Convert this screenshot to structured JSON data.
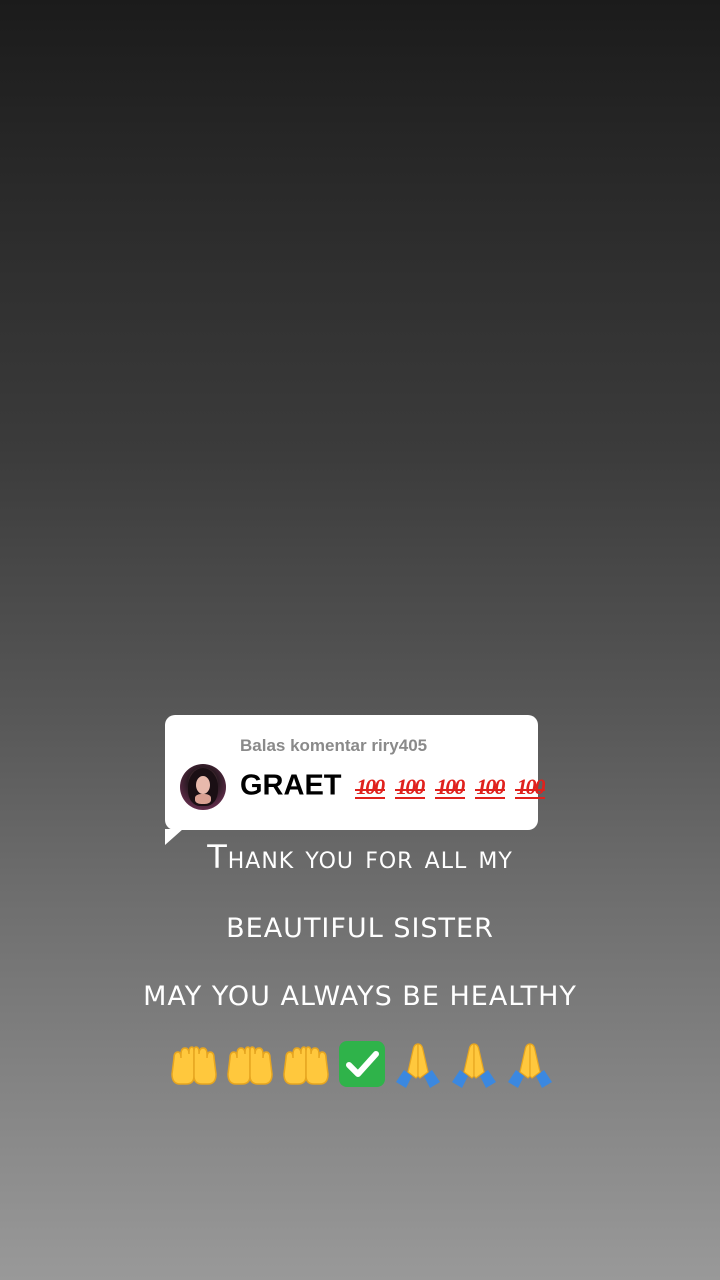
{
  "reply_card": {
    "label": "Balas komentar riry405",
    "comment_text": "GRAET",
    "comment_emoji": [
      "hundred-points-icon",
      "hundred-points-icon",
      "hundred-points-icon",
      "hundred-points-icon",
      "hundred-points-icon"
    ],
    "avatar": "user-avatar"
  },
  "caption": {
    "line1": "Thank you for all my",
    "line2": "BEAUTIFUL SISTER",
    "line3": "MAY YOU ALWAYS BE HEALTHY"
  },
  "emoji_row": [
    "open-hands-icon",
    "open-hands-icon",
    "open-hands-icon",
    "check-mark-button-icon",
    "folded-hands-icon",
    "folded-hands-icon",
    "folded-hands-icon"
  ],
  "colors": {
    "hundred_red": "#e0211d",
    "check_green": "#2fb34a",
    "hands_yellow": "#ffc83d",
    "sleeve_blue": "#3b88e0"
  }
}
